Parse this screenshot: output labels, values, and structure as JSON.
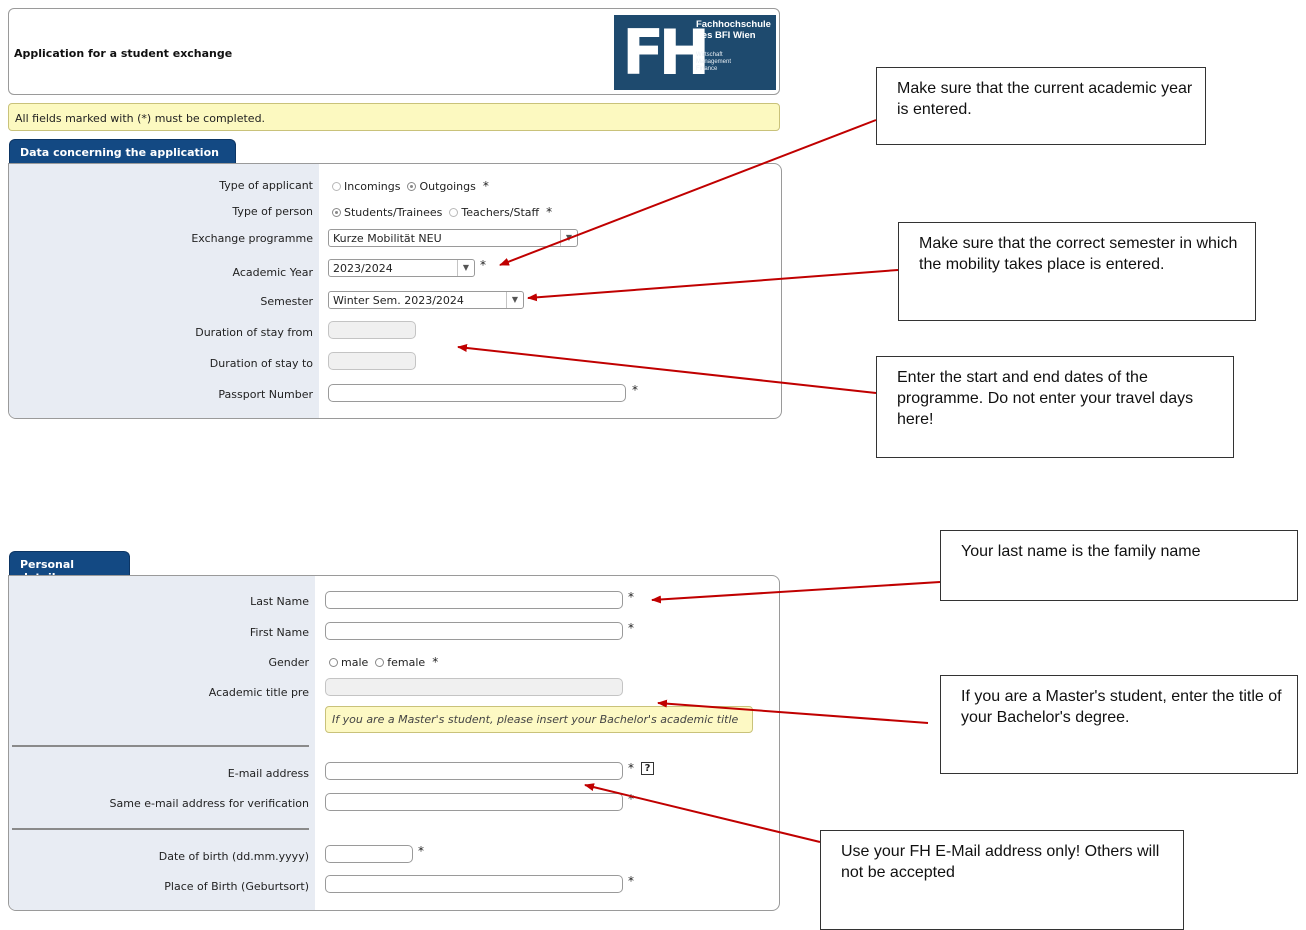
{
  "header": {
    "title": "Application for a student exchange",
    "logo": {
      "mark": "FH",
      "line1": "Fachhochschule",
      "line2": "des BFI Wien",
      "line3": "Wirtschaft",
      "line4": "Management",
      "line5": "Finance"
    }
  },
  "required_notice": "All fields marked with (*) must be completed.",
  "required_mark": "*",
  "application": {
    "tab_label": "Data concerning the application",
    "type_of_applicant": {
      "label": "Type of applicant",
      "options": [
        "Incomings",
        "Outgoings"
      ],
      "selected": "Outgoings"
    },
    "type_of_person": {
      "label": "Type of person",
      "options": [
        "Students/Trainees",
        "Teachers/Staff"
      ],
      "selected": "Students/Trainees"
    },
    "exchange_programme": {
      "label": "Exchange programme",
      "value": "Kurze Mobilität NEU"
    },
    "academic_year": {
      "label": "Academic Year",
      "value": "2023/2024"
    },
    "semester": {
      "label": "Semester",
      "value": "Winter Sem. 2023/2024"
    },
    "duration_from": {
      "label": "Duration of stay from",
      "value": ""
    },
    "duration_to": {
      "label": "Duration of stay to",
      "value": ""
    },
    "passport": {
      "label": "Passport Number",
      "value": ""
    }
  },
  "personal": {
    "tab_label": "Personal details",
    "last_name": {
      "label": "Last Name",
      "value": ""
    },
    "first_name": {
      "label": "First Name",
      "value": ""
    },
    "gender": {
      "label": "Gender",
      "options": [
        "male",
        "female"
      ]
    },
    "academic_title_pre": {
      "label": "Academic title pre",
      "value": "",
      "hint": "If you are a Master's student, please insert your Bachelor's academic title"
    },
    "email": {
      "label": "E-mail address",
      "value": "",
      "help": "?"
    },
    "email_confirm": {
      "label": "Same e-mail address for verification",
      "value": ""
    },
    "dob": {
      "label": "Date of birth (dd.mm.yyyy)",
      "value": ""
    },
    "place_of_birth": {
      "label": "Place of Birth (Geburtsort)",
      "value": ""
    }
  },
  "callouts": {
    "academic_year": "Make sure that the current academic year is entered.",
    "semester": "Make sure that the correct semester in which the mobility takes place is entered.",
    "dates": "Enter the start and end dates of the programme. Do not enter your travel days here!",
    "last_name": "Your last name is the family name",
    "title": "If you are a Master's student, enter the title of your Bachelor's degree.",
    "email": "Use your FH E-Mail address only! Others will not be accepted"
  },
  "colors": {
    "tab_blue": "#134983",
    "logo_blue": "#1e4a6e",
    "notice_yellow": "#fcf9c0",
    "label_column": "#e8ecf3",
    "arrow_red": "#c00000"
  }
}
